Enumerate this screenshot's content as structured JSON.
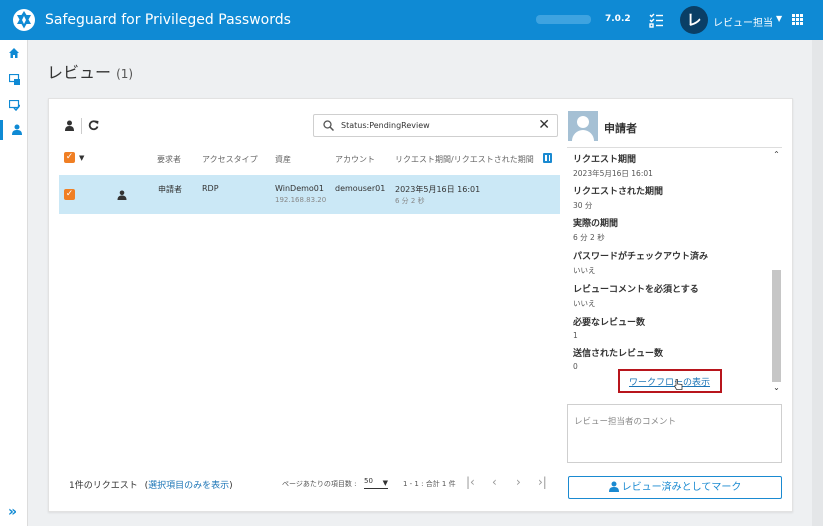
{
  "app": {
    "title": "Safeguard for Privileged Passwords",
    "version": "7.0.2",
    "user_initial": "レ",
    "user_name": "レビュー担当"
  },
  "page": {
    "title": "レビュー",
    "count": "(1)"
  },
  "search": {
    "value": "Status:PendingReview",
    "clear_label": "✕"
  },
  "table": {
    "headers": {
      "requester": "要求者",
      "access_type": "アクセスタイプ",
      "asset": "資産",
      "account": "アカウント",
      "period": "リクエスト期間/リクエストされた期間"
    },
    "row": {
      "requester": "申請者",
      "access_type": "RDP",
      "asset": "WinDemo01",
      "asset_ip": "192.168.83.20",
      "account": "demouser01",
      "period": "2023年5月16日 16:01",
      "duration": "6 分 2 秒"
    }
  },
  "footer": {
    "count_text": "1件のリクエスト",
    "show_selected_link": "選択項目のみを表示",
    "paren_open": "(",
    "paren_close": ")",
    "per_page_label": "ページあたりの項目数 :",
    "per_page_value": "50",
    "range_text": "1 - 1 : 合計 1 件"
  },
  "detail": {
    "title": "申請者",
    "props": [
      {
        "label": "リクエスト期間",
        "value": "2023年5月16日 16:01"
      },
      {
        "label": "リクエストされた期間",
        "value": "30 分"
      },
      {
        "label": "実際の期間",
        "value": "6 分 2 秒"
      },
      {
        "label": "パスワードがチェックアウト済み",
        "value": "いいえ"
      },
      {
        "label": "レビューコメントを必須とする",
        "value": "いいえ"
      },
      {
        "label": "必要なレビュー数",
        "value": "1"
      },
      {
        "label": "送信されたレビュー数",
        "value": "0"
      }
    ],
    "workflow_link": "ワークフローの表示",
    "comment_placeholder": "レビュー担当者のコメント",
    "mark_button": "レビュー済みとしてマーク"
  },
  "colors": {
    "brand": "#0f8ad4",
    "accent_orange": "#f07f24",
    "selected_row": "#cbe8f6",
    "highlight_red": "#b8151c"
  }
}
